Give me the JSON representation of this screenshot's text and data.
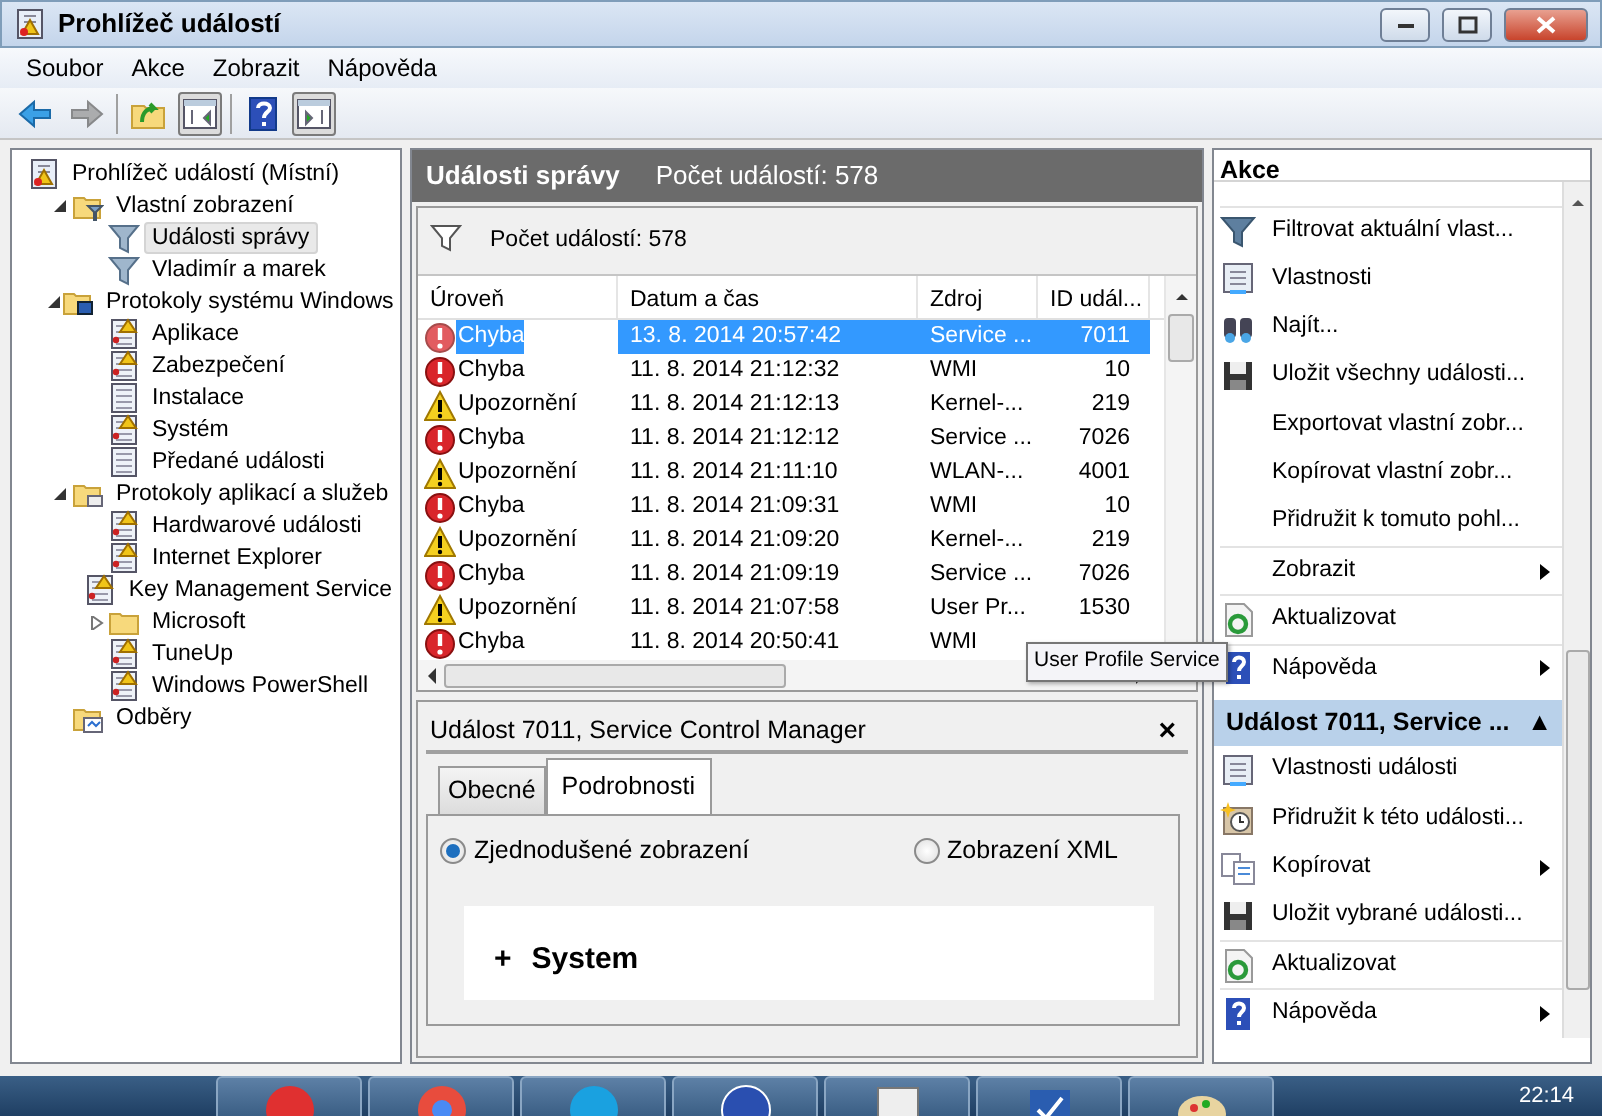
{
  "window": {
    "title": "Prohlížeč událostí"
  },
  "menu": [
    "Soubor",
    "Akce",
    "Zobrazit",
    "Nápověda"
  ],
  "toolbar": [
    {
      "kind": "back",
      "disabled": false
    },
    {
      "kind": "forward",
      "disabled": true
    },
    {
      "kind": "separator"
    },
    {
      "kind": "up-folder",
      "disabled": false
    },
    {
      "kind": "pane-left",
      "disabled": false
    },
    {
      "kind": "separator"
    },
    {
      "kind": "help",
      "disabled": false
    },
    {
      "kind": "pane-right",
      "disabled": false
    }
  ],
  "tree": [
    {
      "label": "Prohlížeč událostí (Místní)",
      "kind": "eventviewer",
      "selected": false,
      "children": [
        {
          "label": "Vlastní zobrazení",
          "kind": "folder-filter",
          "expanded": true,
          "selected": false,
          "children": [
            {
              "label": "Události správy",
              "kind": "filter",
              "selected": true
            },
            {
              "label": "Vladimír a marek",
              "kind": "filter",
              "selected": false
            }
          ]
        },
        {
          "label": "Protokoly systému Windows",
          "kind": "folder-windows",
          "expanded": true,
          "selected": false,
          "children": [
            {
              "label": "Aplikace",
              "kind": "log-warning",
              "selected": false
            },
            {
              "label": "Zabezpečení",
              "kind": "log-warning",
              "selected": false
            },
            {
              "label": "Instalace",
              "kind": "log",
              "selected": false
            },
            {
              "label": "Systém",
              "kind": "log-warning",
              "selected": false
            },
            {
              "label": "Předané události",
              "kind": "log",
              "selected": false
            }
          ]
        },
        {
          "label": "Protokoly aplikací a služeb",
          "kind": "folder-apps",
          "expanded": true,
          "selected": false,
          "children": [
            {
              "label": "Hardwarové události",
              "kind": "log-warning",
              "selected": false
            },
            {
              "label": "Internet Explorer",
              "kind": "log-warning",
              "selected": false
            },
            {
              "label": "Key Management Service",
              "kind": "log-warning",
              "selected": false
            },
            {
              "label": "Microsoft",
              "kind": "folder",
              "expanded": false,
              "selected": false
            },
            {
              "label": "TuneUp",
              "kind": "log-warning",
              "selected": false
            },
            {
              "label": "Windows PowerShell",
              "kind": "log-warning",
              "selected": false
            }
          ]
        },
        {
          "label": "Odběry",
          "kind": "subscriptions",
          "selected": false
        }
      ]
    }
  ],
  "center": {
    "title": "Události správy",
    "count": "Počet událostí: 578",
    "filter_text": "Počet událostí: 578",
    "columns": [
      "Úroveň",
      "Datum a čas",
      "Zdroj",
      "ID udál..."
    ],
    "rows": [
      {
        "kind": "error",
        "level": "Chyba",
        "datetime": "13. 8. 2014 20:57:42",
        "source": "Service ...",
        "id": "7011",
        "selected": true
      },
      {
        "kind": "error",
        "level": "Chyba",
        "datetime": "11. 8. 2014 21:12:32",
        "source": "WMI",
        "id": "10",
        "selected": false
      },
      {
        "kind": "warning",
        "level": "Upozornění",
        "datetime": "11. 8. 2014 21:12:13",
        "source": "Kernel-...",
        "id": "219",
        "selected": false
      },
      {
        "kind": "error",
        "level": "Chyba",
        "datetime": "11. 8. 2014 21:12:12",
        "source": "Service ...",
        "id": "7026",
        "selected": false
      },
      {
        "kind": "warning",
        "level": "Upozornění",
        "datetime": "11. 8. 2014 21:11:10",
        "source": "WLAN-...",
        "id": "4001",
        "selected": false
      },
      {
        "kind": "error",
        "level": "Chyba",
        "datetime": "11. 8. 2014 21:09:31",
        "source": "WMI",
        "id": "10",
        "selected": false
      },
      {
        "kind": "warning",
        "level": "Upozornění",
        "datetime": "11. 8. 2014 21:09:20",
        "source": "Kernel-...",
        "id": "219",
        "selected": false
      },
      {
        "kind": "error",
        "level": "Chyba",
        "datetime": "11. 8. 2014 21:09:19",
        "source": "Service ...",
        "id": "7026",
        "selected": false
      },
      {
        "kind": "warning",
        "level": "Upozornění",
        "datetime": "11. 8. 2014 21:07:58",
        "source": "User Pr...",
        "id": "1530",
        "selected": false
      },
      {
        "kind": "error",
        "level": "Chyba",
        "datetime": "11. 8. 2014 20:50:41",
        "source": "WMI",
        "id": "",
        "selected": false
      }
    ],
    "tooltip": "User Profile Service"
  },
  "detail": {
    "title": "Událost 7011, Service Control Manager",
    "close": "×",
    "tabs": [
      {
        "label": "Obecné",
        "selected": false
      },
      {
        "label": "Podrobnosti",
        "selected": true
      }
    ],
    "radios": [
      {
        "label": "Zjednodušené zobrazení",
        "selected": true
      },
      {
        "label": "Zobrazení XML",
        "selected": false
      }
    ],
    "section": {
      "expander": "+",
      "label": "System"
    }
  },
  "actions": {
    "header": "Akce",
    "items": [
      {
        "label": "Filtrovat aktuální vlast...",
        "kind": "filter",
        "submenu": false,
        "group_start": true
      },
      {
        "label": "Vlastnosti",
        "kind": "properties",
        "submenu": false,
        "group_start": false
      },
      {
        "label": "Najít...",
        "kind": "find",
        "submenu": false,
        "group_start": false
      },
      {
        "label": "Uložit všechny události...",
        "kind": "save",
        "submenu": false,
        "group_start": false
      },
      {
        "label": "Exportovat vlastní zobr...",
        "kind": "none",
        "submenu": false,
        "group_start": false
      },
      {
        "label": "Kopírovat vlastní zobr...",
        "kind": "none",
        "submenu": false,
        "group_start": false
      },
      {
        "label": "Přidružit k tomuto pohl...",
        "kind": "none",
        "submenu": false,
        "group_start": false
      },
      {
        "label": "Zobrazit",
        "kind": "none",
        "submenu": true,
        "group_start": true
      },
      {
        "label": "Aktualizovat",
        "kind": "refresh",
        "submenu": false,
        "group_start": true
      },
      {
        "label": "Nápověda",
        "kind": "help",
        "submenu": true,
        "group_start": true
      }
    ],
    "section_header": "Událost 7011, Service ...",
    "section_glyph": "▲",
    "section_items": [
      {
        "label": "Vlastnosti události",
        "kind": "properties",
        "submenu": false,
        "group_start": false
      },
      {
        "label": "Přidružit k této události...",
        "kind": "task",
        "submenu": false,
        "group_start": false
      },
      {
        "label": "Kopírovat",
        "kind": "copy",
        "submenu": true,
        "group_start": false
      },
      {
        "label": "Uložit vybrané události...",
        "kind": "save",
        "submenu": false,
        "group_start": false
      },
      {
        "label": "Aktualizovat",
        "kind": "refresh",
        "submenu": false,
        "group_start": true
      },
      {
        "label": "Nápověda",
        "kind": "help",
        "submenu": true,
        "group_start": true
      }
    ]
  },
  "taskbar": {
    "clock": "22:14"
  }
}
